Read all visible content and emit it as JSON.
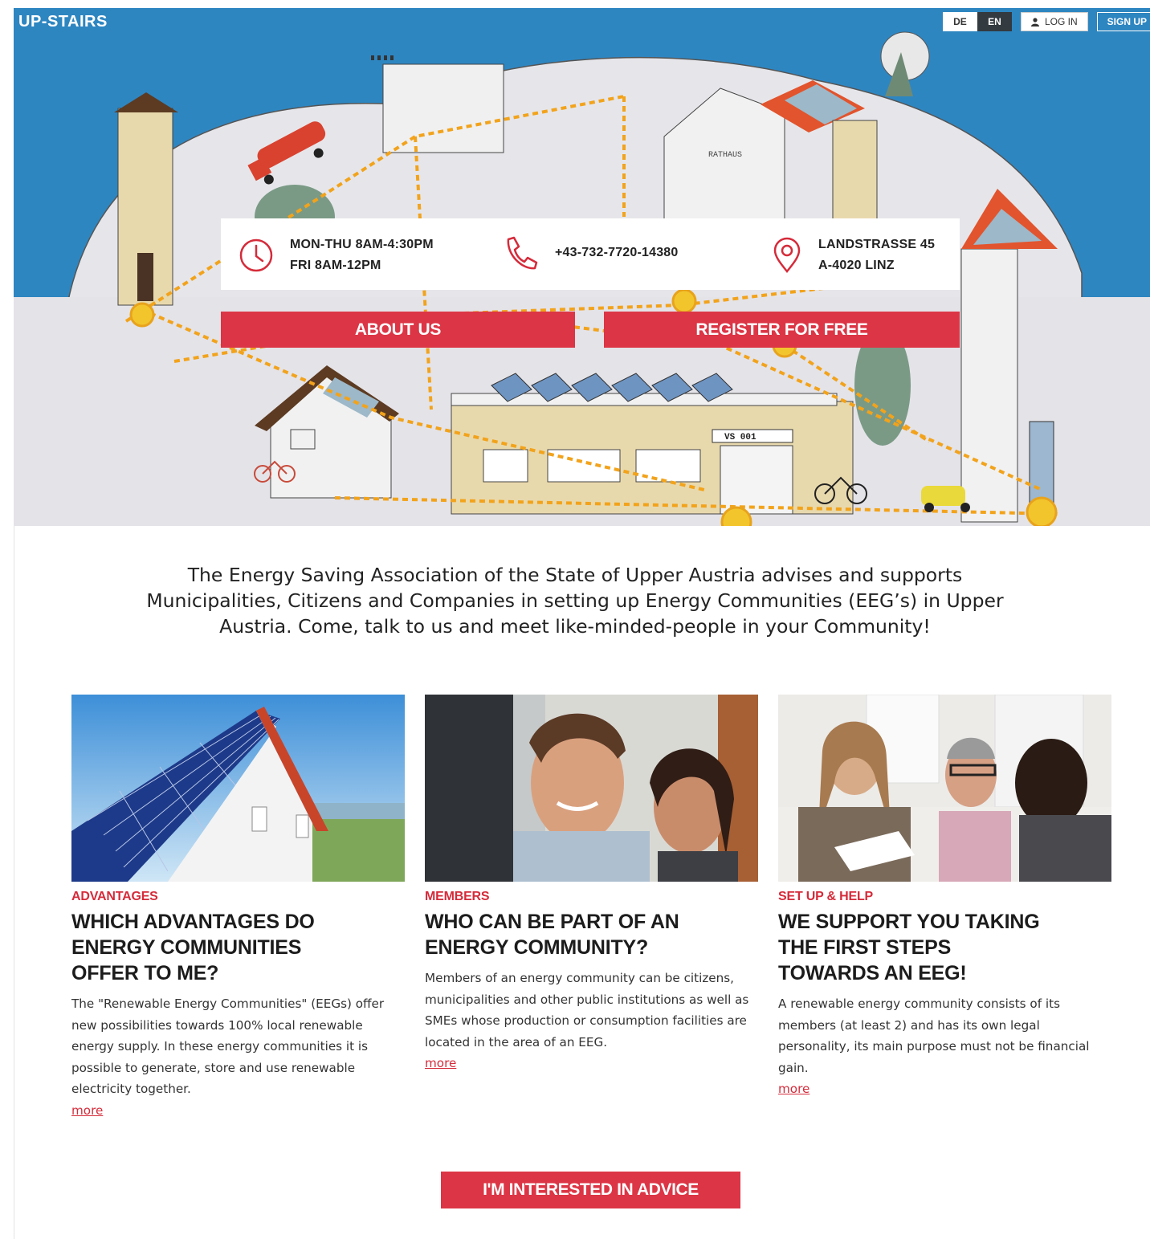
{
  "brand": {
    "name": "UP-STAIRS"
  },
  "top_nav": {
    "lang_de": "DE",
    "lang_en": "EN",
    "login_label": "LOG IN",
    "signup_label": "SIGN UP",
    "login_icon": "user-icon"
  },
  "hero": {
    "hours_line1": "MON-THU 8AM-4:30PM",
    "hours_line2": "FRI 8AM-12PM",
    "phone": "+43-732-7720-14380",
    "address_line1": "LANDSTRASSE 45",
    "address_line2": "A-4020 LINZ",
    "about_label": "ABOUT US",
    "register_label": "REGISTER FOR FREE",
    "illustration_texts": {
      "town_hall": "RATHAUS",
      "school": "VS 001"
    },
    "icons": [
      "clock-icon",
      "phone-icon",
      "location-pin-icon"
    ]
  },
  "intro": {
    "text": "The Energy Saving Association of the State of Upper Austria advises and supports Municipalities, Citizens and Companies in setting up Energy Communities (EEG’s) in Upper Austria. Come, talk to us and meet like-minded-people in your Community!"
  },
  "cards": [
    {
      "kicker": "ADVANTAGES",
      "title": "WHICH ADVANTAGES DO ENERGY COMMUNITIES OFFER TO ME?",
      "body": "The \"Renewable Energy Communities\" (EEGs) offer new possibilities towards 100% local renewable energy supply. In these energy communities it is possible to generate, store and use renewable electricity together.",
      "more": "more"
    },
    {
      "kicker": "MEMBERS",
      "title": "WHO CAN BE PART OF AN ENERGY COMMUNITY?",
      "body": "Members of an energy community can be citizens, municipalities and other public institutions as well as SMEs whose production or consumption facilities are located in the area of an EEG.",
      "more": "more"
    },
    {
      "kicker": "SET UP & HELP",
      "title": "WE SUPPORT YOU TAKING THE FIRST STEPS TOWARDS AN EEG!",
      "body": "A renewable energy community consists of its members (at least 2) and has its own legal personality, its main purpose must not be financial gain.",
      "more": "more"
    }
  ],
  "cta": {
    "label": "I'M INTERESTED IN ADVICE"
  },
  "colors": {
    "accent": "#dc3545",
    "sky": "#2e86c1",
    "ground": "#e4e3e8"
  }
}
